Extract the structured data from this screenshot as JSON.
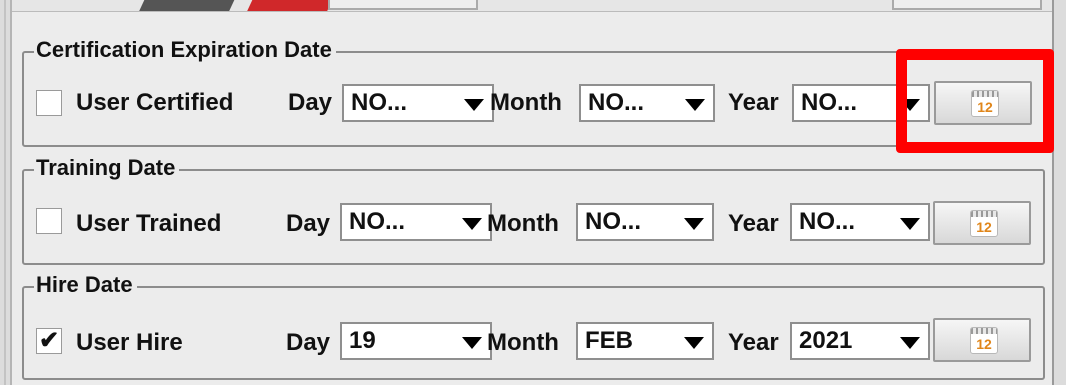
{
  "sections": [
    {
      "title": "Certification Expiration Date",
      "checkbox_label": "User Certified",
      "checked": false,
      "checkbox_mark": "",
      "day_label": "Day",
      "day_value": "NO...",
      "month_label": "Month",
      "month_value": "NO...",
      "year_label": "Year",
      "year_value": "NO...",
      "calendar_icon_text": "12",
      "highlighted": true
    },
    {
      "title": "Training Date",
      "checkbox_label": "User Trained",
      "checked": false,
      "checkbox_mark": "",
      "day_label": "Day",
      "day_value": "NO...",
      "month_label": "Month",
      "month_value": "NO...",
      "year_label": "Year",
      "year_value": "NO...",
      "calendar_icon_text": "12"
    },
    {
      "title": "Hire Date",
      "checkbox_label": "User Hire",
      "checked": true,
      "checkbox_mark": "✔",
      "day_label": "Day",
      "day_value": "19",
      "month_label": "Month",
      "month_value": "FEB",
      "year_label": "Year",
      "year_value": "2021",
      "calendar_icon_text": "12"
    }
  ],
  "colors": {
    "highlight": "#ff0000",
    "calendar_accent": "#e0861a",
    "background": "#ececec"
  },
  "icons": {
    "calendar": "calendar-icon",
    "dropdown": "chevron-down-icon"
  }
}
